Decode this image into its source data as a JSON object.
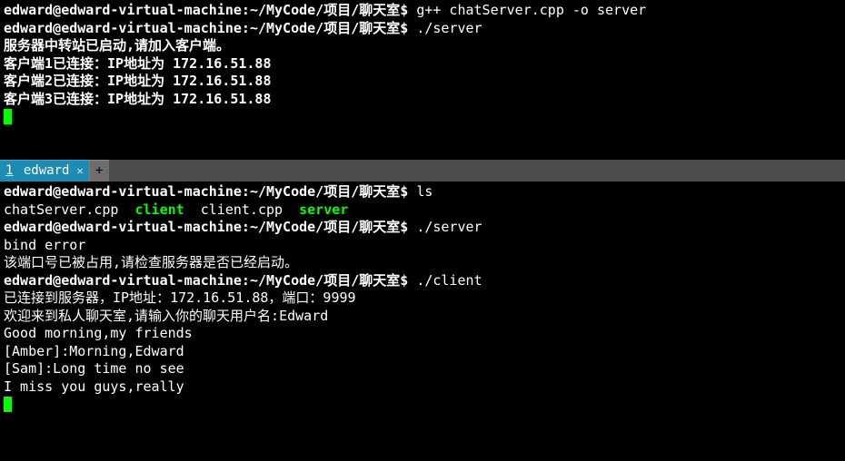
{
  "top": {
    "prompt1": {
      "userhost": "edward@edward-virtual-machine",
      "sep": ":",
      "path": "~/MyCode/项目/聊天室",
      "dollar": "$",
      "cmd": "g++ chatServer.cpp -o server"
    },
    "prompt2": {
      "userhost": "edward@edward-virtual-machine",
      "sep": ":",
      "path": "~/MyCode/项目/聊天室",
      "dollar": "$",
      "cmd": "./server"
    },
    "out1": "服务器中转站已启动,请加入客户端。",
    "out2": "客户端1已连接：IP地址为 172.16.51.88",
    "out3": "客户端2已连接：IP地址为 172.16.51.88",
    "out4": "客户端3已连接：IP地址为 172.16.51.88"
  },
  "tabs": {
    "tab1": {
      "index": "1",
      "title": "edward"
    },
    "add": "+"
  },
  "bottom": {
    "prompt1": {
      "userhost": "edward@edward-virtual-machine",
      "sep": ":",
      "path": "~/MyCode/项目/聊天室",
      "dollar": "$",
      "cmd": "ls"
    },
    "ls": {
      "f1": "chatServer.cpp",
      "f2": "client",
      "f3": "client.cpp",
      "f4": "server"
    },
    "prompt2": {
      "userhost": "edward@edward-virtual-machine",
      "sep": ":",
      "path": "~/MyCode/项目/聊天室",
      "dollar": "$",
      "cmd": "./server"
    },
    "out1": "bind error",
    "out2": "该端口号已被占用,请检查服务器是否已经启动。",
    "prompt3": {
      "userhost": "edward@edward-virtual-machine",
      "sep": ":",
      "path": "~/MyCode/项目/聊天室",
      "dollar": "$",
      "cmd": "./client"
    },
    "out3": "已连接到服务器，IP地址：172.16.51.88，端口：9999",
    "out4_prefix": "欢迎来到私人聊天室,请输入你的聊天用户名:",
    "out4_input": "Edward",
    "out5": "Good morning,my friends",
    "out6": "[Amber]:Morning,Edward",
    "out7": "[Sam]:Long time no see",
    "out8": "I miss you guys,really"
  }
}
